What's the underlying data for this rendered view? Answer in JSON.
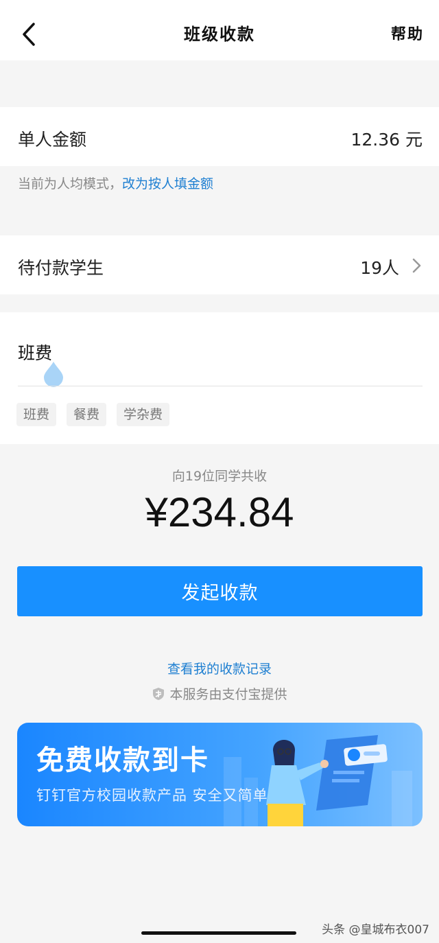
{
  "nav": {
    "title": "班级收款",
    "help": "帮助"
  },
  "amount": {
    "label": "单人金额",
    "value": "12.36 元"
  },
  "mode": {
    "note": "当前为人均模式，",
    "switch_link": "改为按人填金额"
  },
  "students": {
    "label": "待付款学生",
    "count": "19人"
  },
  "purpose": {
    "value": "班费",
    "chips": [
      "班费",
      "餐费",
      "学杂费"
    ]
  },
  "summary": {
    "label": "向19位同学共收",
    "total": "¥234.84"
  },
  "actions": {
    "start_label": "发起收款",
    "records_link": "查看我的收款记录",
    "service_note": "本服务由支付宝提供"
  },
  "banner": {
    "title": "免费收款到卡",
    "subtitle": "钉钉官方校园收款产品 安全又简单"
  },
  "watermark": "头条 @皇城布衣007",
  "colors": {
    "accent": "#1890ff",
    "link": "#1e7fd1"
  }
}
